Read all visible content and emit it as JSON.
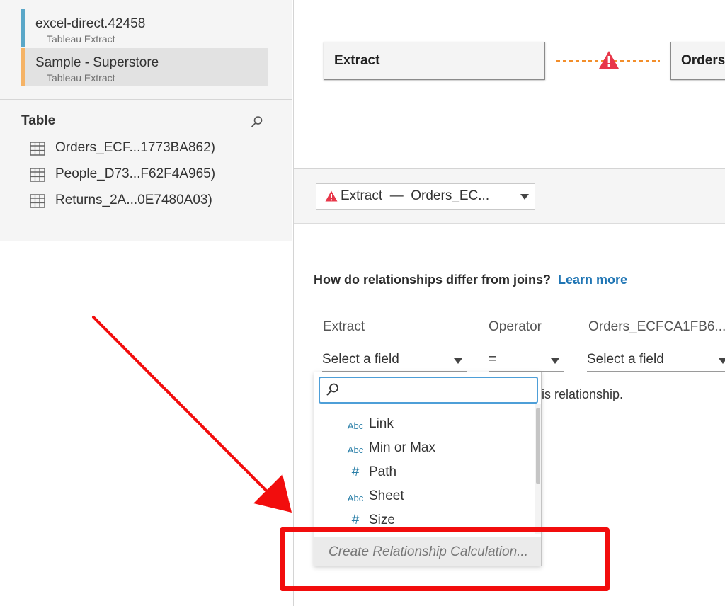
{
  "data_sources": [
    {
      "name": "excel-direct.42458",
      "type": "Tableau Extract",
      "color": "#5aa7c8"
    },
    {
      "name": "Sample - Superstore",
      "type": "Tableau Extract",
      "color": "#f5b366"
    }
  ],
  "table_section": {
    "heading": "Table",
    "tables": [
      "Orders_ECF...1773BA862)",
      "People_D73...F62F4A965)",
      "Returns_2A...0E7480A03)"
    ]
  },
  "canvas": {
    "left_node": "Extract",
    "right_node": "Orders_",
    "link_color": "#f28e2b",
    "warning_color": "#e8374a"
  },
  "relationship_select": {
    "left": "Extract",
    "separator": "—",
    "right": "Orders_EC..."
  },
  "help": {
    "question": "How do relationships differ from joins?",
    "link": "Learn more"
  },
  "columns": {
    "left_header": "Extract",
    "operator_header": "Operator",
    "right_header": "Orders_ECFCA1FB6...",
    "left_value": "Select a field",
    "operator_value": "=",
    "right_value": "Select a field"
  },
  "relationship_note": "is relationship.",
  "dropdown": {
    "search_value": "",
    "items": [
      {
        "type": "Abc",
        "label": "Link"
      },
      {
        "type": "Abc",
        "label": "Min or Max"
      },
      {
        "type": "#",
        "label": "Path"
      },
      {
        "type": "Abc",
        "label": "Sheet"
      },
      {
        "type": "#",
        "label": "Size"
      }
    ],
    "footer": "Create Relationship Calculation..."
  },
  "annotation_color": "#f20d0d"
}
